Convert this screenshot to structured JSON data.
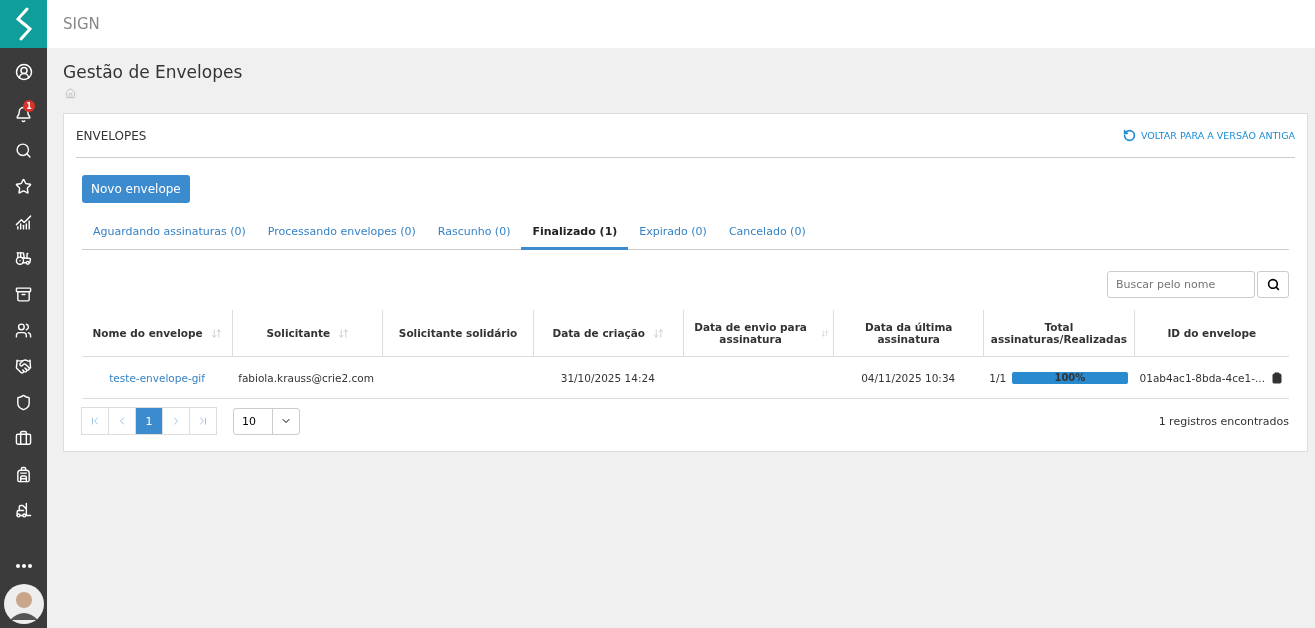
{
  "app": {
    "title": "SIGN"
  },
  "sidebar": {
    "notification_badge": "1"
  },
  "page": {
    "title": "Gestão de Envelopes"
  },
  "card": {
    "title": "ENVELOPES",
    "legacy_link": "VOLTAR PARA A VERSÃO ANTIGA",
    "new_button": "Novo envelope"
  },
  "tabs": [
    {
      "label": "Aguardando assinaturas (0)",
      "selected": false
    },
    {
      "label": "Processando envelopes (0)",
      "selected": false
    },
    {
      "label": "Rascunho (0)",
      "selected": false
    },
    {
      "label": "Finalizado (1)",
      "selected": true
    },
    {
      "label": "Expirado (0)",
      "selected": false
    },
    {
      "label": "Cancelado (0)",
      "selected": false
    }
  ],
  "search": {
    "placeholder": "Buscar pelo nome"
  },
  "table": {
    "columns": [
      {
        "label": "Nome do envelope",
        "sortable": true
      },
      {
        "label": "Solicitante",
        "sortable": true
      },
      {
        "label": "Solicitante solidário",
        "sortable": false
      },
      {
        "label": "Data de criação",
        "sortable": true
      },
      {
        "label": "Data de envio para assinatura",
        "sortable": true
      },
      {
        "label": "Data da última assinatura",
        "sortable": false
      },
      {
        "label": "Total assinaturas/Realizadas",
        "sortable": false
      },
      {
        "label": "ID do envelope",
        "sortable": false
      }
    ],
    "rows": [
      {
        "name": "teste-envelope-gif",
        "requester": "fabiola.krauss@crie2.com",
        "co_requester": "",
        "created": "31/10/2025 14:24",
        "sent": "",
        "last_signature": "04/11/2025 10:34",
        "signatures": "1/1",
        "progress": {
          "level": 1,
          "label": "100%"
        },
        "id": "01ab4ac1-8bda-4ce1-..."
      }
    ]
  },
  "pagination": {
    "pages": [
      {
        "label": "1",
        "selected": true
      }
    ],
    "page_size": "10",
    "total": "1 registros encontrados"
  }
}
